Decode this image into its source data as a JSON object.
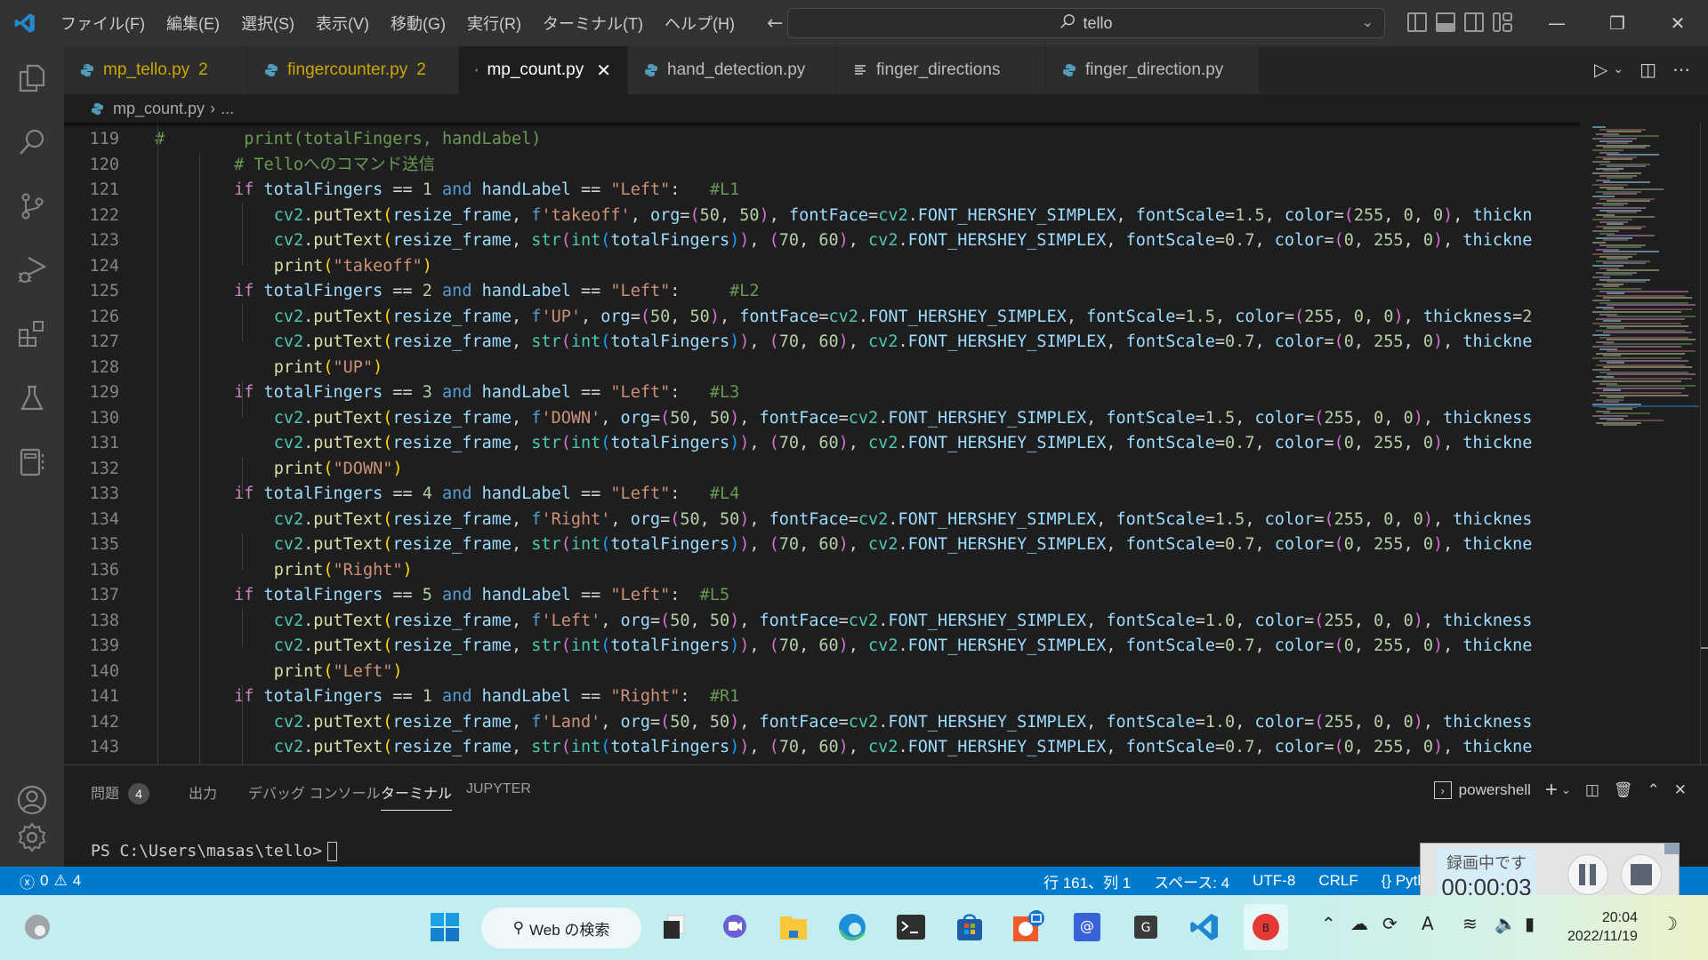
{
  "titlebar": {
    "menu": [
      "ファイル(F)",
      "編集(E)",
      "選択(S)",
      "表示(V)",
      "移動(G)",
      "実行(R)",
      "ターミナル(T)",
      "ヘルプ(H)"
    ],
    "search_text": "tello"
  },
  "tabs": [
    {
      "name": "mp_tello.py",
      "badge": "2",
      "type": "python",
      "state": "warning"
    },
    {
      "name": "fingercounter.py",
      "badge": "2",
      "type": "python",
      "state": "warning"
    },
    {
      "name": "mp_count.py",
      "badge": "",
      "type": "python",
      "state": "active"
    },
    {
      "name": "hand_detection.py",
      "badge": "",
      "type": "python",
      "state": "normal"
    },
    {
      "name": "finger_directions",
      "badge": "",
      "type": "text",
      "state": "normal"
    },
    {
      "name": "finger_direction.py",
      "badge": "",
      "type": "python",
      "state": "normal"
    }
  ],
  "breadcrumb": {
    "file": "mp_count.py",
    "rest": "..."
  },
  "editor": {
    "lines": [
      {
        "n": "119",
        "text": "#        print(totalFingers, handLabel)"
      },
      {
        "n": "120",
        "text": "        # Telloへのコマンド送信"
      },
      {
        "n": "121",
        "text": "        if totalFingers == 1 and handLabel == \"Left\":   #L1"
      },
      {
        "n": "122",
        "text": "            cv2.putText(resize_frame, f'takeoff', org=(50, 50), fontFace=cv2.FONT_HERSHEY_SIMPLEX, fontScale=1.5, color=(255, 0, 0), thickn"
      },
      {
        "n": "123",
        "text": "            cv2.putText(resize_frame, str(int(totalFingers)), (70, 60), cv2.FONT_HERSHEY_SIMPLEX, fontScale=0.7, color=(0, 255, 0), thickne"
      },
      {
        "n": "124",
        "text": "            print(\"takeoff\")"
      },
      {
        "n": "125",
        "text": "        if totalFingers == 2 and handLabel == \"Left\":     #L2"
      },
      {
        "n": "126",
        "text": "            cv2.putText(resize_frame, f'UP', org=(50, 50), fontFace=cv2.FONT_HERSHEY_SIMPLEX, fontScale=1.5, color=(255, 0, 0), thickness=2"
      },
      {
        "n": "127",
        "text": "            cv2.putText(resize_frame, str(int(totalFingers)), (70, 60), cv2.FONT_HERSHEY_SIMPLEX, fontScale=0.7, color=(0, 255, 0), thickne"
      },
      {
        "n": "128",
        "text": "            print(\"UP\")"
      },
      {
        "n": "129",
        "text": "        if totalFingers == 3 and handLabel == \"Left\":   #L3"
      },
      {
        "n": "130",
        "text": "            cv2.putText(resize_frame, f'DOWN', org=(50, 50), fontFace=cv2.FONT_HERSHEY_SIMPLEX, fontScale=1.5, color=(255, 0, 0), thickness"
      },
      {
        "n": "131",
        "text": "            cv2.putText(resize_frame, str(int(totalFingers)), (70, 60), cv2.FONT_HERSHEY_SIMPLEX, fontScale=0.7, color=(0, 255, 0), thickne"
      },
      {
        "n": "132",
        "text": "            print(\"DOWN\")"
      },
      {
        "n": "133",
        "text": "        if totalFingers == 4 and handLabel == \"Left\":   #L4"
      },
      {
        "n": "134",
        "text": "            cv2.putText(resize_frame, f'Right', org=(50, 50), fontFace=cv2.FONT_HERSHEY_SIMPLEX, fontScale=1.5, color=(255, 0, 0), thicknes"
      },
      {
        "n": "135",
        "text": "            cv2.putText(resize_frame, str(int(totalFingers)), (70, 60), cv2.FONT_HERSHEY_SIMPLEX, fontScale=0.7, color=(0, 255, 0), thickne"
      },
      {
        "n": "136",
        "text": "            print(\"Right\")"
      },
      {
        "n": "137",
        "text": "        if totalFingers == 5 and handLabel == \"Left\":  #L5"
      },
      {
        "n": "138",
        "text": "            cv2.putText(resize_frame, f'Left', org=(50, 50), fontFace=cv2.FONT_HERSHEY_SIMPLEX, fontScale=1.0, color=(255, 0, 0), thickness"
      },
      {
        "n": "139",
        "text": "            cv2.putText(resize_frame, str(int(totalFingers)), (70, 60), cv2.FONT_HERSHEY_SIMPLEX, fontScale=0.7, color=(0, 255, 0), thickne"
      },
      {
        "n": "140",
        "text": "            print(\"Left\")"
      },
      {
        "n": "141",
        "text": "        if totalFingers == 1 and handLabel == \"Right\":  #R1"
      },
      {
        "n": "142",
        "text": "            cv2.putText(resize_frame, f'Land', org=(50, 50), fontFace=cv2.FONT_HERSHEY_SIMPLEX, fontScale=1.0, color=(255, 0, 0), thickness"
      },
      {
        "n": "143",
        "text": "            cv2.putText(resize_frame, str(int(totalFingers)), (70, 60), cv2.FONT_HERSHEY_SIMPLEX, fontScale=0.7, color=(0, 255, 0), thickne"
      }
    ]
  },
  "panel": {
    "tabs": [
      {
        "label": "問題",
        "badge": "4"
      },
      {
        "label": "出力"
      },
      {
        "label": "デバッグ コンソール"
      },
      {
        "label": "ターミナル",
        "active": true
      },
      {
        "label": "JUPYTER"
      }
    ],
    "terminal_name": "powershell",
    "prompt": "PS C:\\Users\\masas\\tello>"
  },
  "statusbar": {
    "errors": "0",
    "warnings": "4",
    "position": "行 161、列 1",
    "spaces": "スペース: 4",
    "encoding": "UTF-8",
    "eol": "CRLF",
    "language": "Pytho"
  },
  "recorder": {
    "status": "録画中です",
    "time": "00:00:03"
  },
  "taskbar": {
    "search_label": "Web の検索",
    "time": "20:04",
    "date": "2022/11/19",
    "ime": "A"
  },
  "colors": {
    "accent": "#007acc",
    "titlebar": "#323233",
    "editor_bg": "#1e1e1e",
    "warning": "#cca700"
  }
}
